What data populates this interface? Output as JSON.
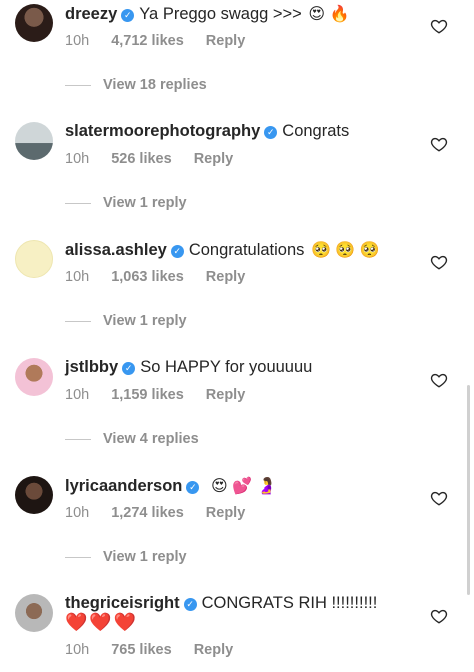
{
  "comments": [
    {
      "username": "dreezy",
      "text": "Ya Preggo swagg >>>",
      "emojis": "😍 🔥",
      "time": "10h",
      "likes": "4,712 likes",
      "reply": "Reply",
      "view_replies": "View 18 replies"
    },
    {
      "username": "slatermoorephotography",
      "text": "Congrats",
      "emojis": "",
      "time": "10h",
      "likes": "526 likes",
      "reply": "Reply",
      "view_replies": "View 1 reply"
    },
    {
      "username": "alissa.ashley",
      "text": "Congratulations",
      "emojis": "🥺 🥺 🥺",
      "time": "10h",
      "likes": "1,063 likes",
      "reply": "Reply",
      "view_replies": "View 1 reply"
    },
    {
      "username": "jstlbby",
      "text": "So HAPPY for youuuuu",
      "emojis": "",
      "time": "10h",
      "likes": "1,159 likes",
      "reply": "Reply",
      "view_replies": "View 4 replies"
    },
    {
      "username": "lyricaanderson",
      "text": "",
      "emojis": "😍 💕 🤰",
      "time": "10h",
      "likes": "1,274 likes",
      "reply": "Reply",
      "view_replies": "View 1 reply"
    },
    {
      "username": "thegriceisright",
      "text": "CONGRATS RIH !!!!!!!!!!",
      "emojis": "❤️❤️❤️",
      "time": "10h",
      "likes": "765 likes",
      "reply": "Reply",
      "view_replies": ""
    }
  ],
  "colors": {
    "verified": "#3897f0",
    "muted": "#8e8e8e",
    "text": "#262626"
  },
  "icons": {
    "verified": "verified-badge-icon",
    "like": "heart-outline-icon"
  }
}
